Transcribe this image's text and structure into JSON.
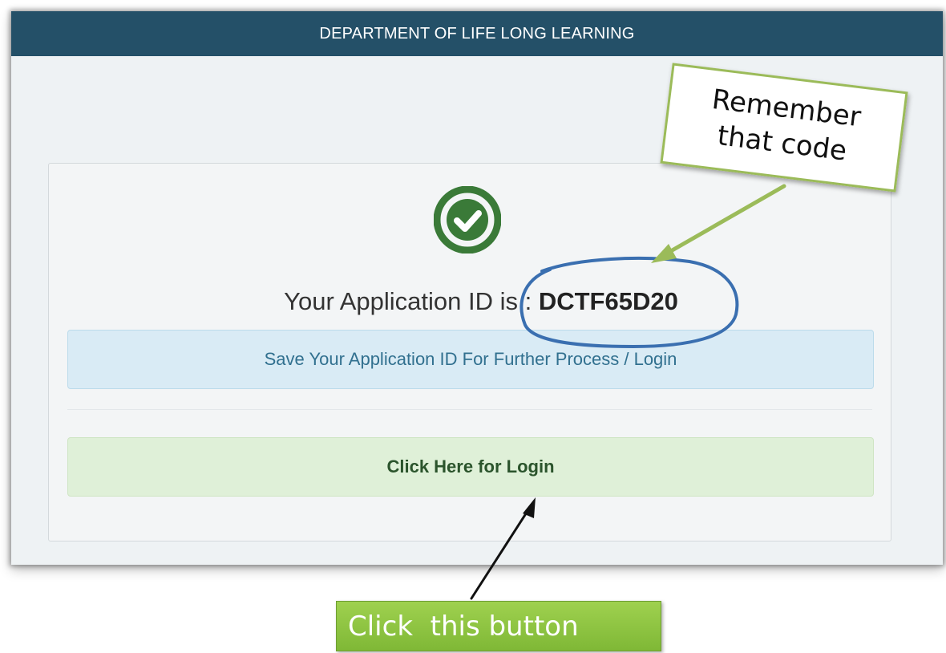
{
  "header": {
    "title": "DEPARTMENT OF LIFE LONG LEARNING"
  },
  "result": {
    "status_icon": "check-circle-icon",
    "id_label": "Your Application ID is : ",
    "id_value": "DCTF65D20"
  },
  "info": {
    "message": "Save Your Application ID For Further Process / Login"
  },
  "login": {
    "button_label": "Click Here for Login"
  },
  "annotations": {
    "note_line1": "Remember",
    "note_line2": "that code",
    "callout_label": "Click  this button"
  },
  "colors": {
    "header_bg": "#245068",
    "success_green": "#3a7a38",
    "info_bg": "#d9ebf5",
    "login_bg": "#dff0d8",
    "annotation_green": "#9bbb59",
    "circle_blue": "#3a6fb0"
  }
}
